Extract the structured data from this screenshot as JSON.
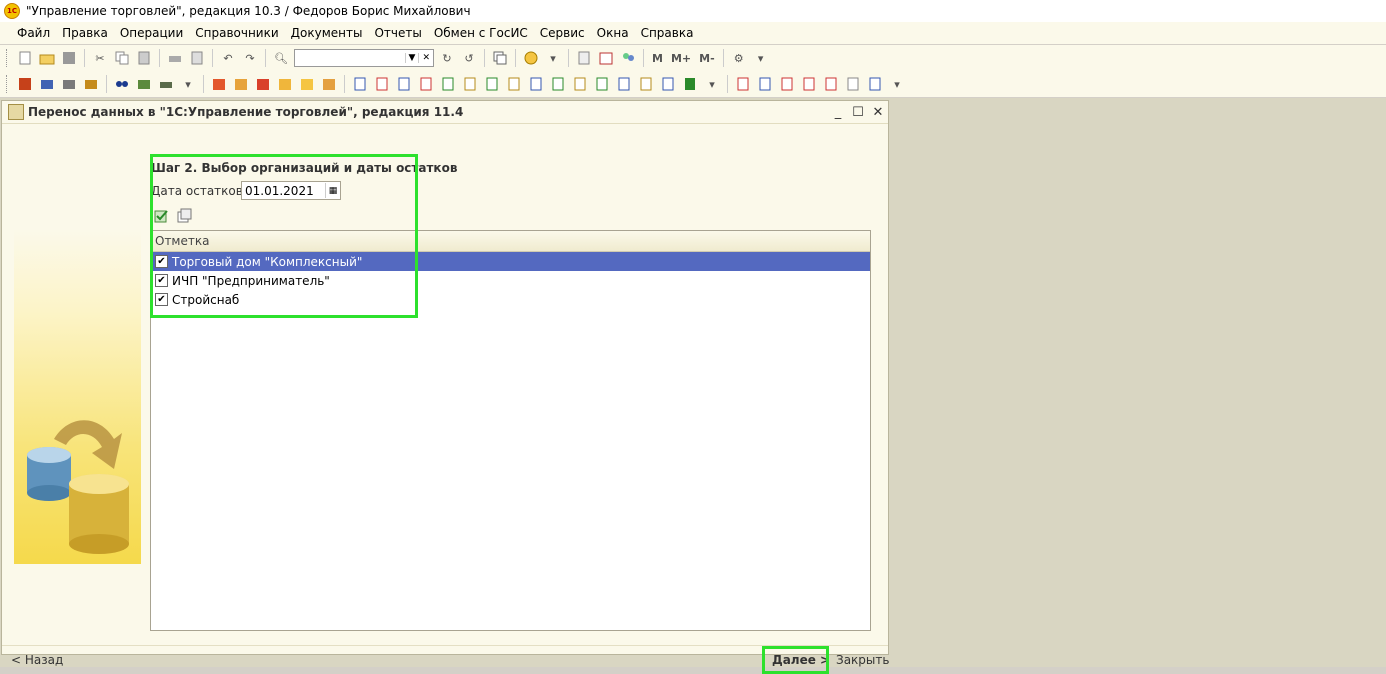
{
  "app": {
    "title": "\"Управление торговлей\", редакция 10.3 / Федоров Борис Михайлович",
    "logo_text": "1С"
  },
  "menu": [
    "Файл",
    "Правка",
    "Операции",
    "Справочники",
    "Документы",
    "Отчеты",
    "Обмен с ГосИС",
    "Сервис",
    "Окна",
    "Справка"
  ],
  "toolbar": {
    "search_value": "",
    "m_label": "M",
    "mplus_label": "M+",
    "mminus_label": "M-"
  },
  "window": {
    "title": "Перенос данных в \"1С:Управление торговлей\", редакция 11.4",
    "step_title": "Шаг 2. Выбор организаций и даты остатков",
    "date_label": "Дата остатков:",
    "date_value": "01.01.2021",
    "table_header": "Отметка",
    "rows": [
      {
        "label": "Торговый дом \"Комплексный\"",
        "checked": true,
        "selected": true
      },
      {
        "label": "ИЧП \"Предприниматель\"",
        "checked": true,
        "selected": false
      },
      {
        "label": "Стройснаб",
        "checked": true,
        "selected": false
      }
    ],
    "back_label": "< Назад",
    "next_label": "Далее >",
    "close_label": "Закрыть"
  },
  "colors": {
    "highlight": "#2de12d",
    "selection": "#5469c0",
    "background": "#fbf9ea"
  }
}
